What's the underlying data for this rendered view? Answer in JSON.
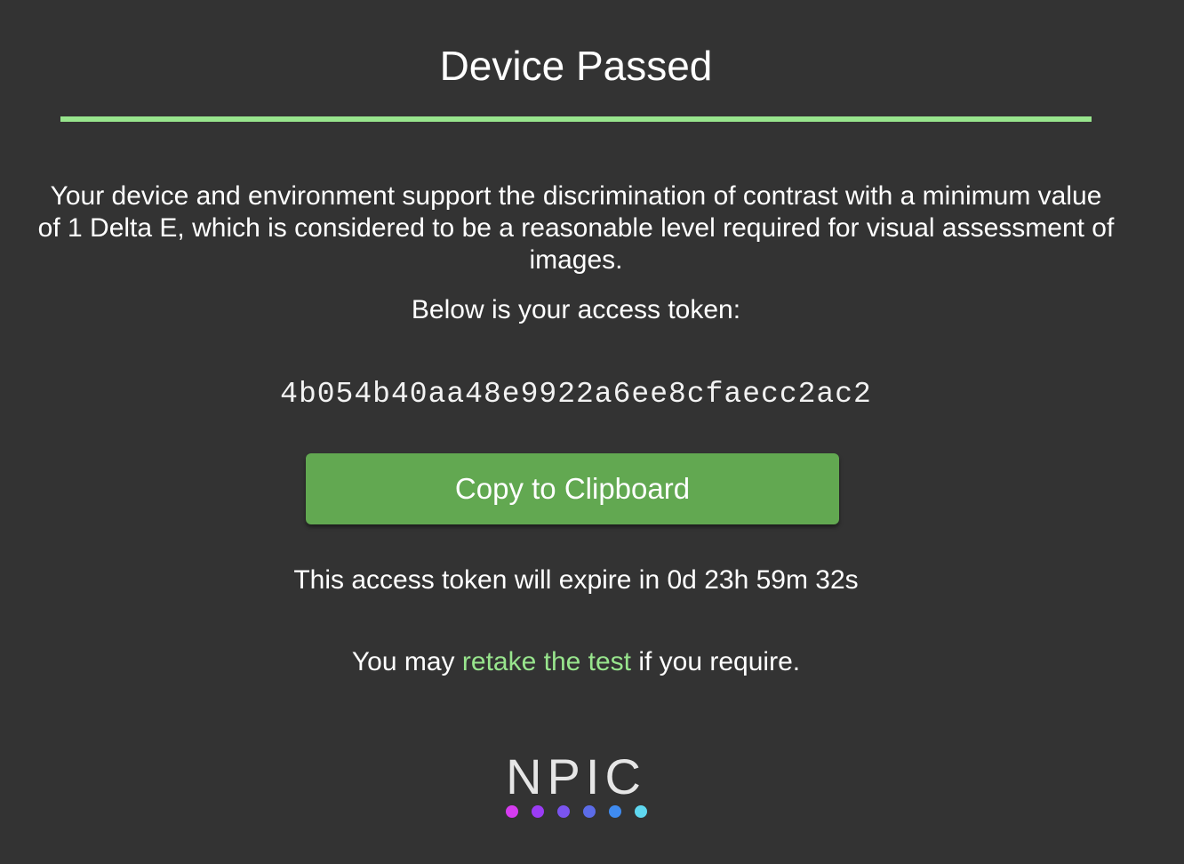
{
  "header": {
    "title": "Device Passed",
    "divider_color": "#98e58d"
  },
  "main": {
    "description": "Your device and environment support the discrimination of contrast with a minimum value of 1 Delta E, which is considered to be a reasonable level required for visual assessment of images.",
    "token_label": "Below is your access token:",
    "token_value": "4b054b40aa48e9922a6ee8cfaecc2ac2",
    "copy_button_label": "Copy to Clipboard",
    "copy_button_color": "#62a851",
    "expiry_text": "This access token will expire in 0d 23h 59m 32s",
    "retake": {
      "prefix": "You may ",
      "link_text": "retake the test",
      "suffix": " if you require.",
      "link_color": "#98e58d"
    }
  },
  "logo": {
    "text": "NPIC",
    "dot_colors": [
      "#d63cf0",
      "#9b3cf5",
      "#7a54ef",
      "#5c6ce8",
      "#3f8bf0",
      "#5fd8f0"
    ]
  },
  "colors": {
    "background": "#333333",
    "text": "#ffffff"
  }
}
